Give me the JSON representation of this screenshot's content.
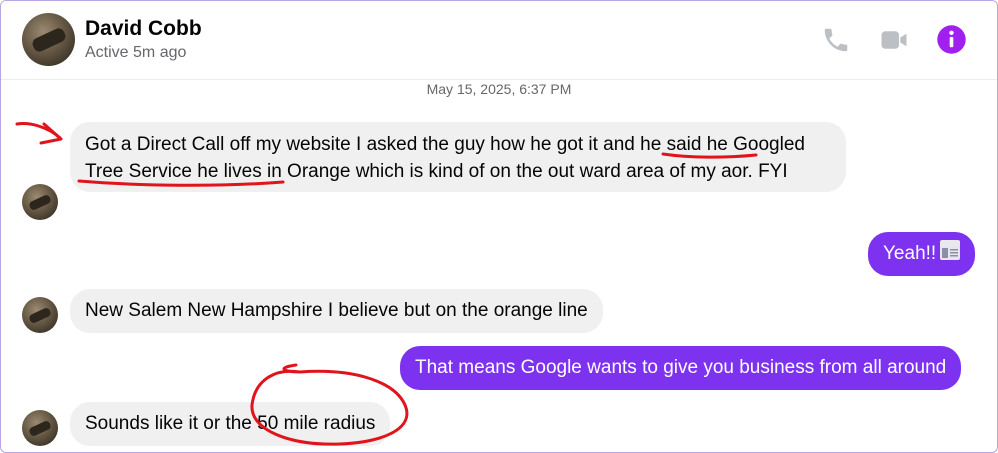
{
  "contact": {
    "name": "David Cobb",
    "status": "Active 5m ago"
  },
  "header_icons": [
    "phone-icon",
    "video-camera-icon",
    "info-icon"
  ],
  "accent_color": "#7c32ee",
  "date_divider": "May 15, 2025, 6:37 PM",
  "messages": [
    {
      "direction": "in",
      "text": "Got a Direct Call off my website I asked the guy how he got it and he said he Googled Tree Service he lives in Orange which is kind of on the out ward area of my aor. FYI"
    },
    {
      "direction": "out",
      "text": "Yeah!!",
      "emoji": "newspaper-icon"
    },
    {
      "direction": "in",
      "text": "New Salem New Hampshire I believe but on the orange line"
    },
    {
      "direction": "out",
      "text": "That means Google wants to give you business from all around"
    },
    {
      "direction": "in",
      "text": "Sounds like it or the 50 mile radius"
    }
  ],
  "annotation_color": "#e0141b"
}
